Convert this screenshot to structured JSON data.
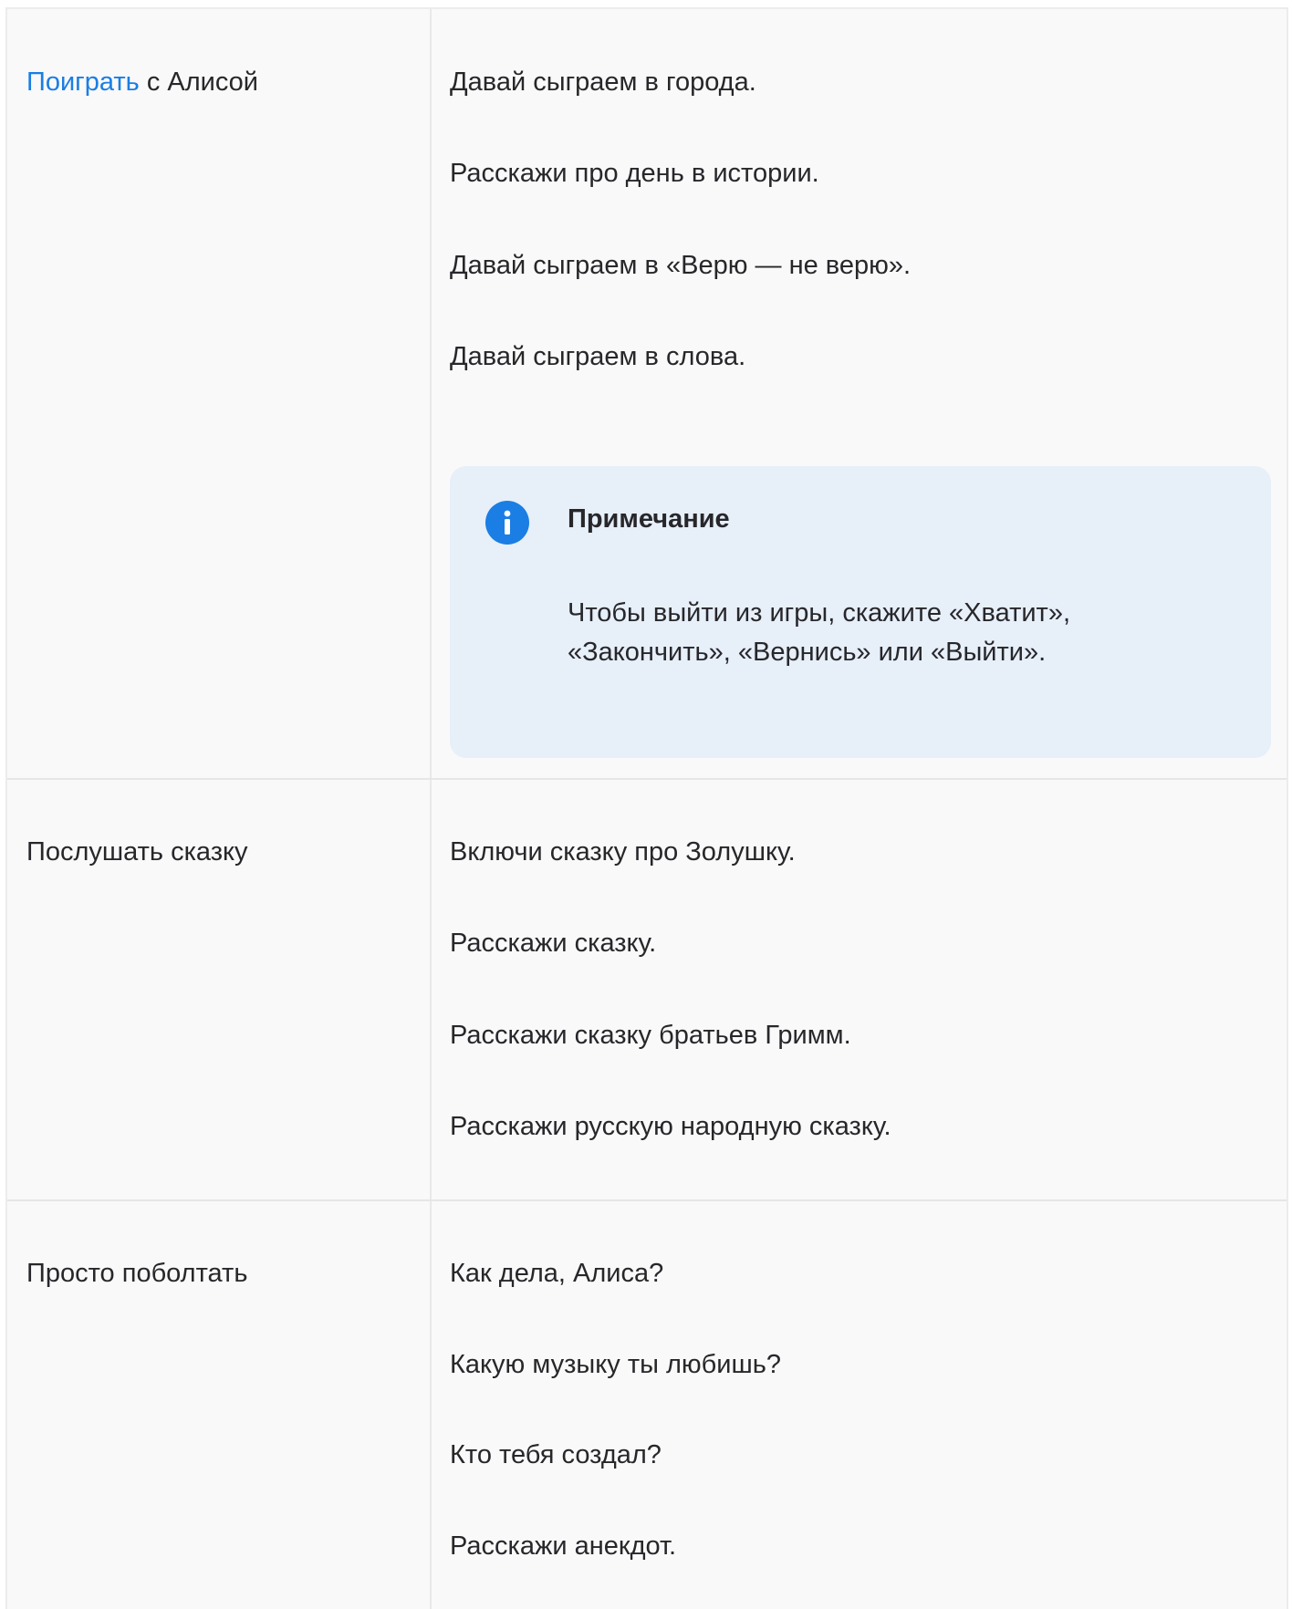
{
  "rows": [
    {
      "left_link": "Поиграть",
      "left_rest": " с Алисой",
      "examples": [
        "Давай сыграем в города.",
        "Расскажи про день в истории.",
        "Давай сыграем в «Верю — не верю».",
        "Давай сыграем в слова."
      ],
      "note": {
        "icon": "info-icon",
        "title": "Примечание",
        "text": "Чтобы выйти из игры, скажите «Хватит», «Закончить», «Вернись» или «Выйти»."
      }
    },
    {
      "left": "Послушать сказку",
      "examples": [
        "Включи сказку про Золушку.",
        "Расскажи сказку.",
        "Расскажи сказку братьев Гримм.",
        "Расскажи русскую народную сказку."
      ]
    },
    {
      "left": "Просто поболтать",
      "examples": [
        "Как дела, Алиса?",
        "Какую музыку ты любишь?",
        "Кто тебя создал?",
        "Расскажи анекдот."
      ]
    }
  ],
  "colors": {
    "link": "#1a7ee4",
    "note_background": "#e7eff9",
    "table_background": "#f9f9f9"
  }
}
